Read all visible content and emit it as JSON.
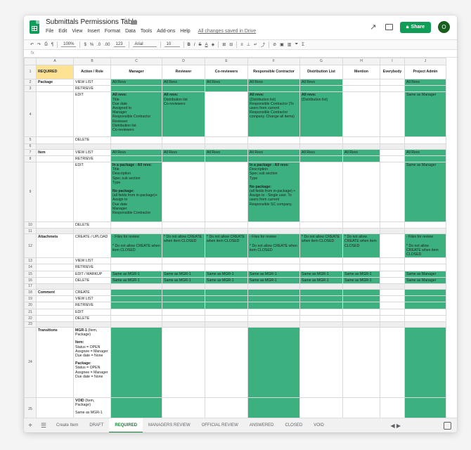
{
  "app": {
    "doc_title": "Submittals Permissions Table",
    "menu": [
      "File",
      "Edit",
      "View",
      "Insert",
      "Format",
      "Data",
      "Tools",
      "Add-ons",
      "Help"
    ],
    "saved_status": "All changes saved in Drive",
    "share_label": "Share",
    "avatar_initial": "O"
  },
  "toolbar": {
    "zoom": "100%",
    "currency": "$",
    "percent": "%",
    "decimals_less": ".0",
    "decimals_more": ".00",
    "number_format": "123",
    "font": "Arial",
    "font_size": "10"
  },
  "columns": [
    "A",
    "B",
    "C",
    "D",
    "E",
    "F",
    "G",
    "H",
    "I",
    "J"
  ],
  "header_row": {
    "A": "REQUIRED",
    "B": "Action / Role",
    "C": "Manager",
    "D": "Reviewer",
    "E": "Co-reviewers",
    "F": "Responsible Contractor",
    "G": "Distribution List",
    "H": "Mention",
    "I": "Everybody",
    "J": "Project Admin"
  },
  "cells": {
    "r2": {
      "A": "Package",
      "B": "VIEW LIST",
      "C": "All Revs",
      "D": "All Revs",
      "E": "All Revs",
      "F": "All Revs",
      "G": "All Revs",
      "J": "All Revs"
    },
    "r3": {
      "B": "RETRIEVE"
    },
    "r4": {
      "B": "EDIT",
      "C_title": "All revs:",
      "C": "Title\nDue date\nAssigned to\nManager\nResponsible Contractor\nReviewer\nDistribution list\nCo-reviewers",
      "D_title": "All revs:",
      "D": "Distribution list\nCo-reviewers",
      "F_title": "All revs:",
      "F": "(Distribution list)\nResponsible Contractor (To users from current Responsible Contractor company. Change all items)",
      "G_title": "All revs:",
      "G": "(Distribution list)",
      "J": "Same as Manager"
    },
    "r5": {
      "B": "DELETE"
    },
    "r7": {
      "A": "Item",
      "B": "VIEW LIST",
      "C": "All Revs",
      "D": "All Revs",
      "E": "All Revs",
      "F": "All Revs",
      "G": "All Revs",
      "H": "All Revs",
      "J": "All Revs"
    },
    "r8": {
      "B": "RETRIEVE"
    },
    "r9": {
      "B": "EDIT",
      "C_title": "In a package - All revs:",
      "C": "Title\nDescription\nSpec sub section\nType",
      "C_title2": "No package:",
      "C2": "(all fields from in-package)+\nAssign to\nDue date\nManager\nResponsible Contractor",
      "F_title": "In a package - All revs:",
      "F": "Description\nSpec sub section\nType",
      "F_title2": "No package:",
      "F2": "(all fields from in-package) +\nAssign to - Single user. To users from current Responsible SC company.",
      "J": "Same as Manager"
    },
    "r10": {
      "B": "DELETE"
    },
    "r12": {
      "A": "Attachmets",
      "B": "CREATE / UPLOAD",
      "C": "- Files for review\n\n* Do not allow CREATE when item CLOSED",
      "D": "* Do not allow CREATE when item CLOSED",
      "E": "* Do not allow CREATE when item CLOSED",
      "F": "- Files for review\n\n* Do not allow CREATE when item CLOSED",
      "G": "* Do not allow CREATE when item CLOSED",
      "H": "* Do not allow CREATE when item CLOSED",
      "J": "- Files for review\n\n* Do not allow CREATE when item CLOSED"
    },
    "r13": {
      "B": "VIEW LIST"
    },
    "r14": {
      "B": "RETRIEVE"
    },
    "r15": {
      "B": "EDIT / MARKUP",
      "C": "Same as MGR-1",
      "D": "Same as MGR-1",
      "E": "Same as MGR-1",
      "F": "Same as MGR-1",
      "G": "Same as MGR-1",
      "H": "Same as MGR-1",
      "J": "Same as Manager"
    },
    "r16": {
      "B": "DELETE",
      "C": "Same as MGR-1",
      "D": "Same as MGR-1",
      "E": "Same as MGR-1",
      "F": "Same as MGR-1",
      "G": "Same as MGR-1",
      "H": "Same as MGR-1",
      "J": "Same as Manager"
    },
    "r18": {
      "A": "Comment",
      "B": "CREATE"
    },
    "r19": {
      "B": "VIEW LIST"
    },
    "r20": {
      "B": "RETRIEVE"
    },
    "r21": {
      "B": "EDIT"
    },
    "r22": {
      "B": "DELETE"
    },
    "r24": {
      "A": "Transitions",
      "B_title": "MGR-1",
      "B_suffix": " (Item, Package)",
      "B_item_title": "Item:",
      "B_item": "Status = OPEN\nAssgnee = Manager\nDue date = None",
      "B_pkg_title": "Package:",
      "B_pkg": "Status = OPEN\nAssgnee = Manager\nDue date = None"
    },
    "r25": {
      "B_title": "VOID",
      "B_suffix": " (Item, Package)",
      "B2": "Same as MGR-1"
    }
  },
  "row_numbers": [
    "1",
    "2",
    "3",
    "4",
    "5",
    "6",
    "7",
    "8",
    "9",
    "10",
    "11",
    "12",
    "13",
    "14",
    "15",
    "16",
    "17",
    "18",
    "19",
    "20",
    "21",
    "22",
    "23",
    "24",
    "25"
  ],
  "tabs": [
    "Create Item",
    "DRAFT",
    "REQUIRED",
    "MANAGERS REVIEW",
    "OFFICIAL REVIEW",
    "ANSWERED",
    "CLOSED",
    "VOID"
  ],
  "active_tab": "REQUIRED",
  "colors": {
    "green_fill": "#3cb07e",
    "header_yellow": "#fde293",
    "share_green": "#0f9d58"
  }
}
